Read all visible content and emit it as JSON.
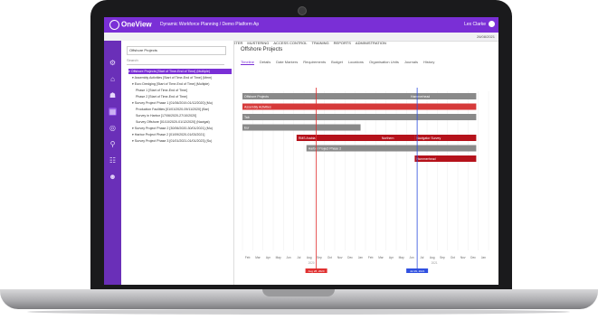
{
  "app": {
    "brand": "OneView",
    "breadcrumb": "Dynamic Workforce Planning / Demo Platform Ap",
    "user": "Lex Clarke"
  },
  "menu": [
    {
      "label": "HOME",
      "active": false
    },
    {
      "label": "SELF SERVICE",
      "active": false
    },
    {
      "label": "ORGANISATION",
      "active": true
    },
    {
      "label": "PEOPLE",
      "active": false
    },
    {
      "label": "RAPTORS",
      "active": false
    },
    {
      "label": "ROSTER",
      "active": false
    },
    {
      "label": "MUSTERING",
      "active": false
    },
    {
      "label": "ACCESS CONTROL",
      "active": false
    },
    {
      "label": "TRAINING",
      "active": false
    },
    {
      "label": "REPORTS",
      "active": false
    },
    {
      "label": "ADMINISTRATION",
      "active": false
    }
  ],
  "menu_date": "26/08/2021",
  "sidebar": {
    "dropdown": "Offshore Projects",
    "search_placeholder": "Search",
    "items": [
      {
        "label": "Offshore Projects [Start of Time-End of Time] (Multiple)",
        "indent": 1,
        "selected": true
      },
      {
        "label": "Assembly Activities [Start of Time-End of Time] (Mem)",
        "indent": 2,
        "selected": false
      },
      {
        "label": "Euro Dredging [Start of Time-End of Time] (Multiple)",
        "indent": 2,
        "selected": false
      },
      {
        "label": "Phase 1 [Start of Time-End of Time]",
        "indent": 3,
        "selected": false
      },
      {
        "label": "Phase 2 [Start of Time-End of Time]",
        "indent": 3,
        "selected": false
      },
      {
        "label": "Survey Project Phase 1 [01/06/2019-01/12/2020] (Mu)",
        "indent": 2,
        "selected": false
      },
      {
        "label": "Production Facilities [01/01/2020-09/11/2020] (Bar)",
        "indent": 3,
        "selected": false
      },
      {
        "label": "Survey in Harbor [17/06/2020-27/10/2020]",
        "indent": 3,
        "selected": false
      },
      {
        "label": "Survey Offshore [01/10/2020-01/12/2020] (Navigat)",
        "indent": 3,
        "selected": false
      },
      {
        "label": "Survey Project Phase 2 [30/06/2020-30/01/2021] (Mu)",
        "indent": 2,
        "selected": false
      },
      {
        "label": "Harbor Project Phase 2 [01/09/2020-01/03/2021]",
        "indent": 2,
        "selected": false
      },
      {
        "label": "Survey Project Phase 3 [01/01/2021-01/01/2023] (Su)",
        "indent": 2,
        "selected": false
      }
    ]
  },
  "main": {
    "title": "Offshore Projects",
    "tabs": [
      {
        "label": "Timeline",
        "active": true
      },
      {
        "label": "Details",
        "active": false
      },
      {
        "label": "Date Markers",
        "active": false
      },
      {
        "label": "Requirements",
        "active": false
      },
      {
        "label": "Budget",
        "active": false
      },
      {
        "label": "Locations",
        "active": false
      },
      {
        "label": "Organisation Units",
        "active": false
      },
      {
        "label": "Journals",
        "active": false
      },
      {
        "label": "History",
        "active": false
      }
    ]
  },
  "gantt": {
    "bars": [
      {
        "row": 0,
        "start": 0.0,
        "end": 0.95,
        "color": "#8a8a8a",
        "label": "Offshore Projects",
        "end_label": "Hammerhead"
      },
      {
        "row": 1,
        "start": 0.0,
        "end": 0.95,
        "color": "#d63a3a",
        "label": "Assembly Activities",
        "end_label": ""
      },
      {
        "row": 2,
        "start": 0.0,
        "end": 0.95,
        "color": "#8a8a8a",
        "label": "Tab",
        "end_label": ""
      },
      {
        "row": 3,
        "start": 0.0,
        "end": 0.48,
        "color": "#8a8a8a",
        "label": "Eur",
        "end_label": ""
      },
      {
        "row": 4,
        "start": 0.22,
        "end": 0.7,
        "color": "#b5121b",
        "label": "RMS Arabia",
        "end_label": "Northern"
      },
      {
        "row": 4,
        "start": 0.7,
        "end": 0.95,
        "color": "#b5121b",
        "label": "Navigator Survey",
        "end_label": ""
      },
      {
        "row": 5,
        "start": 0.26,
        "end": 0.95,
        "color": "#8a8a8a",
        "label": "Harbor Project Phase 2",
        "end_label": ""
      },
      {
        "row": 6,
        "start": 0.7,
        "end": 0.95,
        "color": "#b5121b",
        "label": "Hammerhead",
        "end_label": ""
      }
    ],
    "months": [
      "Feb",
      "Mar",
      "Apr",
      "May",
      "Jun",
      "Jul",
      "Aug",
      "Sep",
      "Oct",
      "Nov",
      "Dec",
      "Jan",
      "Feb",
      "Mar",
      "Apr",
      "May",
      "Jun",
      "Jul",
      "Aug",
      "Sep",
      "Oct",
      "Nov",
      "Dec",
      "Jan"
    ],
    "years": [
      "2020",
      "2021"
    ],
    "markers": [
      {
        "pos": 0.3,
        "color": "#e03030",
        "label": "Aug 28, 2020"
      },
      {
        "pos": 0.71,
        "color": "#3050e0",
        "label": "Jul 29, 2021"
      }
    ]
  }
}
